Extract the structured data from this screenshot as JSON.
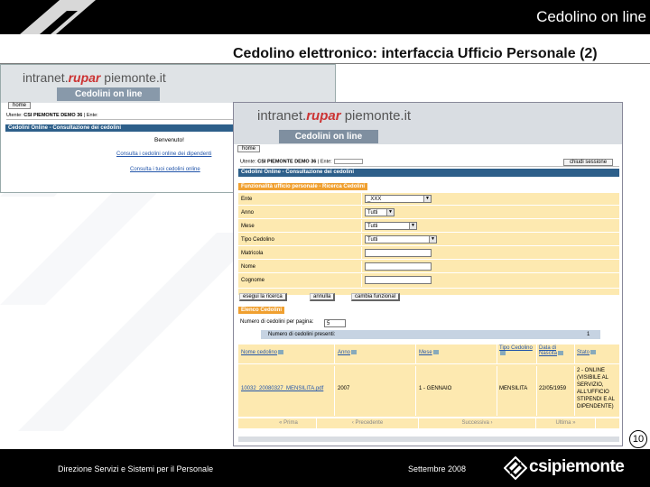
{
  "header": {
    "title": "Cedolino on line"
  },
  "slide": {
    "title": "Cedolino elettronico: interfaccia Ufficio Personale (2)",
    "page_number": "10"
  },
  "back_screen": {
    "brand_prefix": "intranet.",
    "brand_accent": "rupar",
    "brand_suffix": " piemonte.it",
    "app_banner": "Cedolini on line",
    "home_label": "home",
    "user_line_prefix": "Utente: ",
    "user_name": "CSI PIEMONTE DEMO 36",
    "user_line_suffix": " | Ente:",
    "section_bar": "Cedolini Online - Consultazione dei cedolini",
    "welcome": "Benvenuto!",
    "link_all": "Consulta i cedolini online dei dipendenti",
    "link_own": "Consulta i tuoi cedolini online"
  },
  "front_screen": {
    "brand_prefix": "intranet.",
    "brand_accent": "rupar",
    "brand_suffix": " piemonte.it",
    "app_banner": "Cedolini on line",
    "home_label": "home",
    "user_line_prefix": "Utente: ",
    "user_name": "CSI PIEMONTE DEMO 36",
    "user_line_suffix": " | Ente:",
    "logout_label": "chiudi sessione",
    "section_bar": "Cedolini Online - Consultazione dei cedolini",
    "search_section": "Funzionalità ufficio personale - Ricerca Cedolini",
    "form": {
      "ente_label": "Ente",
      "ente_value": "_XXX",
      "anno_label": "Anno",
      "anno_value": "Tutti",
      "mese_label": "Mese",
      "mese_value": "Tutti",
      "tipo_label": "Tipo Cedolino",
      "tipo_value": "Tutti",
      "matricola_label": "Matricola",
      "nome_label": "Nome",
      "cognome_label": "Cognome"
    },
    "buttons": {
      "search": "esegui la ricerca",
      "cancel": "annulla",
      "change": "cambia funzional"
    },
    "results_section": "Elenco Cedolini",
    "per_page_label": "Numero di cedolini per pagina:",
    "per_page_value": "5",
    "present_label": "Numero di cedolini presenti:",
    "present_value": "1",
    "table": {
      "headers": [
        "Nome cedolino",
        "Anno",
        "Mese",
        "Tipo Cedolino",
        "Data di Nascita",
        "Stato"
      ],
      "row": [
        "10032_20080327_MENSILITA.pdf",
        "2007",
        "1 - GENNAIO",
        "MENSILITA",
        "22/05/1959",
        "2 - ONLINE (VISIBILE AL SERVIZIO, ALL'UFFICIO STIPENDI E AL DIPENDENTE)"
      ]
    },
    "pager": [
      "« Prima",
      "‹ Precedente",
      "Successiva ›",
      "Ultima »"
    ]
  },
  "footer": {
    "left": "Direzione Servizi e Sistemi per il Personale",
    "date": "Settembre 2008",
    "logo_text": "csipiemonte"
  },
  "colors": {
    "bar_blue": "#2d5f8a",
    "section_orange": "#f0a030",
    "form_bg": "#fde9b0",
    "brand_red": "#c33333"
  }
}
